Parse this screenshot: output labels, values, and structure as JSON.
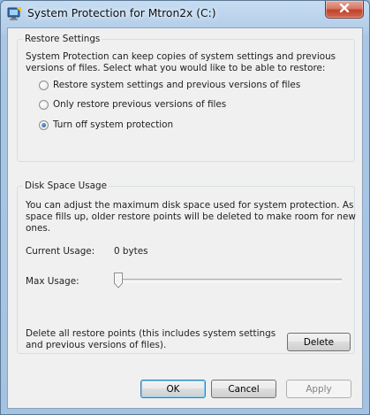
{
  "window": {
    "title": "System Protection for Mtron2x (C:)",
    "icon": "system-properties-icon",
    "close_icon": "close-icon"
  },
  "restore_settings": {
    "legend": "Restore Settings",
    "description_line1": "System Protection can keep copies of system settings and previous",
    "description_line2": "versions of files. Select what you would like to be able to restore:",
    "options": [
      {
        "label": "Restore system settings and previous versions of files",
        "checked": false
      },
      {
        "label": "Only restore previous versions of files",
        "checked": false
      },
      {
        "label": "Turn off system protection",
        "checked": true
      }
    ]
  },
  "disk_space": {
    "legend": "Disk Space Usage",
    "description_line1": "You can adjust the maximum disk space used for system protection. As",
    "description_line2": "space fills up, older restore points will be deleted to make room for new",
    "description_line3": "ones.",
    "current_usage_label": "Current Usage:",
    "current_usage_value": "0 bytes",
    "max_usage_label": "Max Usage:",
    "max_usage_fraction": 0,
    "delete_text_line1": "Delete all restore points (this includes system settings",
    "delete_text_line2": "and previous versions of files).",
    "delete_button": "Delete"
  },
  "footer": {
    "ok": "OK",
    "cancel": "Cancel",
    "apply": "Apply"
  },
  "colors": {
    "title_bar": "#b4cfe9",
    "close_button": "#c0432c",
    "dialog_background": "#f0f0f0",
    "default_button_border": "#3c7fb1"
  }
}
